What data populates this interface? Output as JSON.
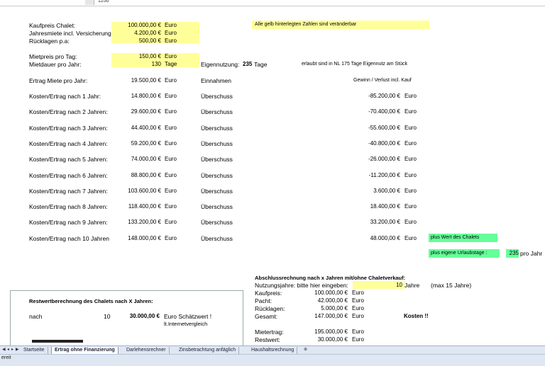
{
  "formula_bar": {
    "value": "1250"
  },
  "inputs": {
    "kaufpreis": {
      "label": "Kaufpreis Chalet:",
      "value": "100.000,00 €",
      "unit": "Euro"
    },
    "jahresmiete": {
      "label": "Jahresmiete incl. Versicherung",
      "value": "4.200,00 €",
      "unit": "Euro"
    },
    "ruecklagen": {
      "label": "Rücklagen p.a:",
      "value": "500,00 €",
      "unit": "Euro"
    },
    "mietpreis": {
      "label": "Mietpreis pro Tag:",
      "value": "150,00 €",
      "unit": "Euro"
    },
    "mietdauer": {
      "label": "Mietdauer pro Jahr:",
      "value": "130",
      "unit": "Tage"
    }
  },
  "note_yellow": "Alle gelb hinterlegten Zahlen sind veränderbar",
  "eigennutzung": {
    "label": "Eigennutzung:",
    "value": "235",
    "unit": "Tage",
    "note": "erlaubt sind in NL 175 Tage Eigennutz am Stück"
  },
  "ertrag": {
    "label": "Ertrag Miete pro Jahr:",
    "value": "19.500,00 €",
    "unit": "Euro",
    "col3": "Einnahmen",
    "col4": "Gewinn / Verlust incl. Kauf"
  },
  "rows": [
    {
      "label": "Kosten/Ertrag nach 1 Jahr:",
      "value": "14.800,00 €",
      "unit": "Euro",
      "type": "Überschuss",
      "gv": "-85.200,00 €",
      "gv_unit": "Euro"
    },
    {
      "label": "Kosten/Ertrag nach 2 Jahren:",
      "value": "29.600,00 €",
      "unit": "Euro",
      "type": "Überschuss",
      "gv": "-70.400,00 €",
      "gv_unit": "Euro"
    },
    {
      "label": "Kosten/Ertrag nach 3 Jahren:",
      "value": "44.400,00 €",
      "unit": "Euro",
      "type": "Überschuss",
      "gv": "-55.600,00 €",
      "gv_unit": "Euro"
    },
    {
      "label": "Kosten/Ertrag nach 4 Jahren:",
      "value": "59.200,00 €",
      "unit": "Euro",
      "type": "Überschuss",
      "gv": "-40.800,00 €",
      "gv_unit": "Euro"
    },
    {
      "label": "Kosten/Ertrag nach 5 Jahren:",
      "value": "74.000,00 €",
      "unit": "Euro",
      "type": "Überschuss",
      "gv": "-26.000,00 €",
      "gv_unit": "Euro"
    },
    {
      "label": "Kosten/Ertrag nach 6 Jahren:",
      "value": "88.800,00 €",
      "unit": "Euro",
      "type": "Überschuss",
      "gv": "-11.200,00 €",
      "gv_unit": "Euro"
    },
    {
      "label": "Kosten/Ertrag nach 7 Jahren:",
      "value": "103.600,00 €",
      "unit": "Euro",
      "type": "Überschuss",
      "gv": "3.600,00 €",
      "gv_unit": "Euro"
    },
    {
      "label": "Kosten/Ertrag nach 8 Jahren:",
      "value": "118.400,00 €",
      "unit": "Euro",
      "type": "Überschuss",
      "gv": "18.400,00 €",
      "gv_unit": "Euro"
    },
    {
      "label": "Kosten/Ertrag nach 9 Jahren:",
      "value": "133.200,00 €",
      "unit": "Euro",
      "type": "Überschuss",
      "gv": "33.200,00 €",
      "gv_unit": "Euro"
    },
    {
      "label": "Kosten/Ertrag nach 10 Jahren",
      "value": "148.000,00 €",
      "unit": "Euro",
      "type": "Überschuss",
      "gv": "48.000,00 €",
      "gv_unit": "Euro"
    }
  ],
  "plus_wert": "plus Wert des Chalets",
  "plus_urlaub": {
    "label": "plus eigene Urlaubstage :",
    "value": "235",
    "suffix": "pro Jahr"
  },
  "abschluss": {
    "title": "Abschlussrechnung nach x Jahren mit/ohne Chaletverkauf:",
    "nutzung": {
      "label": "Nutzungsjahre: bitte hier eingeben:",
      "value": "10",
      "unit": "Jahre",
      "max": "(max 15 Jahre)"
    },
    "kaufpreis": {
      "label": "Kaufpreis:",
      "value": "100.000,00 €",
      "unit": "Euro"
    },
    "pacht": {
      "label": "Pacht:",
      "value": "42.000,00 €",
      "unit": "Euro"
    },
    "ruecklagen": {
      "label": "Rücklagen:",
      "value": "5.000,00 €",
      "unit": "Euro"
    },
    "gesamt": {
      "label": "Gesamt:",
      "value": "147.000,00 €",
      "unit": "Euro",
      "note": "Kosten !!"
    },
    "mietertrag": {
      "label": "Mietertrag:",
      "value": "195.000,00 €",
      "unit": "Euro"
    },
    "restwert": {
      "label": "Restwert:",
      "value": "30.000,00 €",
      "unit": "Euro"
    }
  },
  "restwert_box": {
    "title": "Restwertberechnung des Chalets nach X Jahren:",
    "nach": "nach",
    "years": "10",
    "value": "30.000,00 €",
    "label1": "Euro Schätzwert !",
    "label2": "lt.Internetvergleich"
  },
  "tabs": [
    "Startseite",
    "Ertrag ohne Finanzierung",
    "Darlehensrechner",
    "Zinsbetrachtung anfäglich",
    "Haushaltsrechnung"
  ],
  "status": "ereit",
  "colors": {
    "yellow": "#ffff99",
    "green": "#66ff99",
    "tabbar": "#dfe7f2"
  }
}
